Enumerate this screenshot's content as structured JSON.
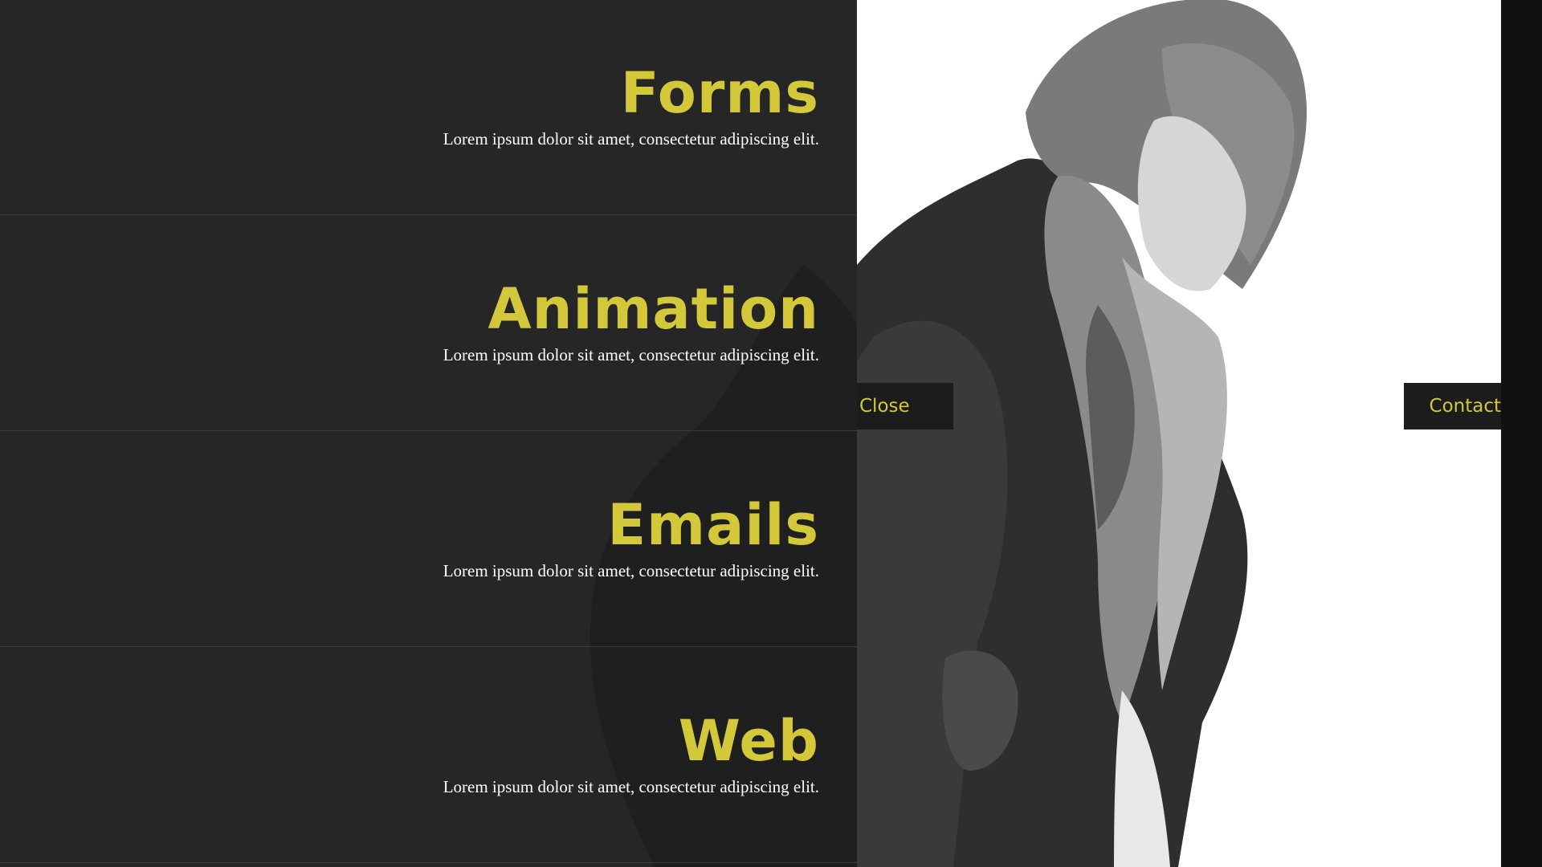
{
  "colors": {
    "accent": "#d2c83a",
    "menu_bg": "#262626",
    "text_light": "#ffffff",
    "button_bg": "#1c1c1c",
    "photo_bg": "#ffffff"
  },
  "menu": {
    "items": [
      {
        "title": "Forms",
        "description": "Lorem ipsum dolor sit amet, consectetur adipiscing elit."
      },
      {
        "title": "Animation",
        "description": "Lorem ipsum dolor sit amet, consectetur adipiscing elit."
      },
      {
        "title": "Emails",
        "description": "Lorem ipsum dolor sit amet, consectetur adipiscing elit."
      },
      {
        "title": "Web",
        "description": "Lorem ipsum dolor sit amet, consectetur adipiscing elit."
      }
    ]
  },
  "buttons": {
    "close_label": "Close",
    "contact_label": "Contact"
  },
  "photo": {
    "subject": "black-and-white photo of a woman in a leather jacket and patterned scarf looking down"
  }
}
